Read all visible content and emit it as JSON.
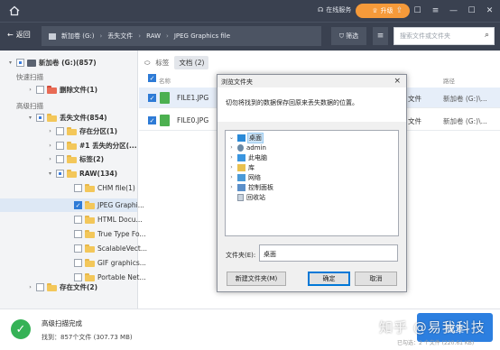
{
  "topbar": {
    "service_label": "在线服务",
    "upgrade_label": "升级",
    "icons": [
      "home-icon",
      "headset-icon",
      "crown-icon",
      "share-icon",
      "feedback-icon",
      "menu-icon",
      "minimize-icon",
      "maximize-icon",
      "close-icon"
    ]
  },
  "nav": {
    "back_label": "返回",
    "breadcrumbs": [
      "新加卷 (G:)",
      "丢失文件",
      "RAW",
      "JPEG Graphics file"
    ],
    "filter_label": "筛选",
    "search_placeholder": "搜索文件或文件夹"
  },
  "tree": {
    "root": {
      "label": "新加卷 (G:)(857)"
    },
    "quick_scan": "快速扫描",
    "deleted": "删除文件(1)",
    "deep_scan": "高级扫描",
    "lost": "丢失文件(854)",
    "existing_partition": "存在分区(1)",
    "lost_partition": "#1 丢失的分区(...",
    "tags": "标签(2)",
    "raw": "RAW(134)",
    "raw_children": [
      "CHM file(1)",
      "JPEG Graphi...",
      "HTML Docu...",
      "True Type Fo...",
      "ScalableVect...",
      "GIF graphics...",
      "Portable Net..."
    ],
    "existing_files": "存在文件(2)"
  },
  "main": {
    "tab_tags": "标签",
    "tab_docs": "文档 (2)",
    "col_name": "名称",
    "col_path": "路径",
    "files": [
      {
        "name": "FILE1.JPG",
        "type": "文件",
        "location": "新加卷 (G:)\\..."
      },
      {
        "name": "FILE0.JPG",
        "type": "文件",
        "location": "新加卷 (G:)\\..."
      }
    ]
  },
  "dialog": {
    "title": "浏览文件夹",
    "close": "×",
    "message": "切勿将找到的数据保存回原来丢失数据的位置。",
    "nodes": [
      "桌面",
      "admin",
      "此电脑",
      "库",
      "网络",
      "控制面板",
      "回收站"
    ],
    "folder_label": "文件夹(E):",
    "folder_value": "桌面",
    "new_folder": "新建文件夹(M)",
    "ok": "确定",
    "cancel": "取消"
  },
  "bottom": {
    "status_title": "高级扫描完成",
    "status_detail": "找到：857个文件 (307.73 MB)",
    "recover": "恢复",
    "selected": "已勾选：2 个文件 (220.61 KB)"
  },
  "watermark": "知乎 @易我科技"
}
